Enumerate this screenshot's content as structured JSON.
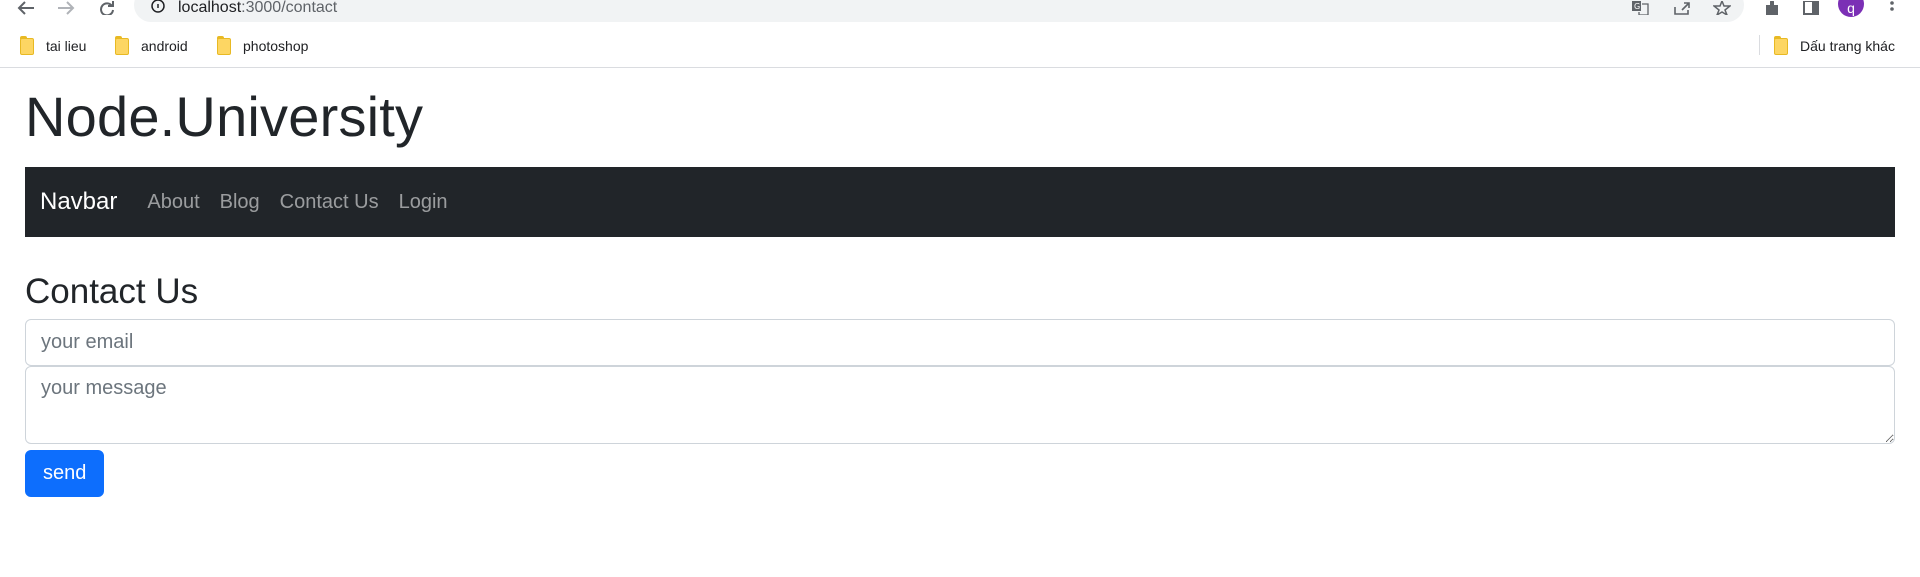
{
  "browser": {
    "url_host": "localhost",
    "url_path": ":3000/contact",
    "avatar_letter": "q",
    "bookmarks": [
      {
        "label": "tai lieu",
        "icon": "folder-icon"
      },
      {
        "label": "android",
        "icon": "folder-icon"
      },
      {
        "label": "photoshop",
        "icon": "folder-icon"
      }
    ],
    "other_bookmarks": "Dấu trang khác",
    "icons": [
      "back-icon",
      "forward-icon",
      "reload-icon",
      "site-info-icon",
      "translate-icon",
      "share-icon",
      "star-icon",
      "extensions-icon",
      "side-panel-icon",
      "menu-icon"
    ]
  },
  "site": {
    "title": "Node.University"
  },
  "navbar": {
    "brand": "Navbar",
    "links": [
      "About",
      "Blog",
      "Contact Us",
      "Login"
    ],
    "background": "#212529"
  },
  "contact": {
    "heading": "Contact Us",
    "email_placeholder": "your email",
    "message_placeholder": "your message",
    "send_label": "send",
    "button_color": "#0d6efd"
  }
}
